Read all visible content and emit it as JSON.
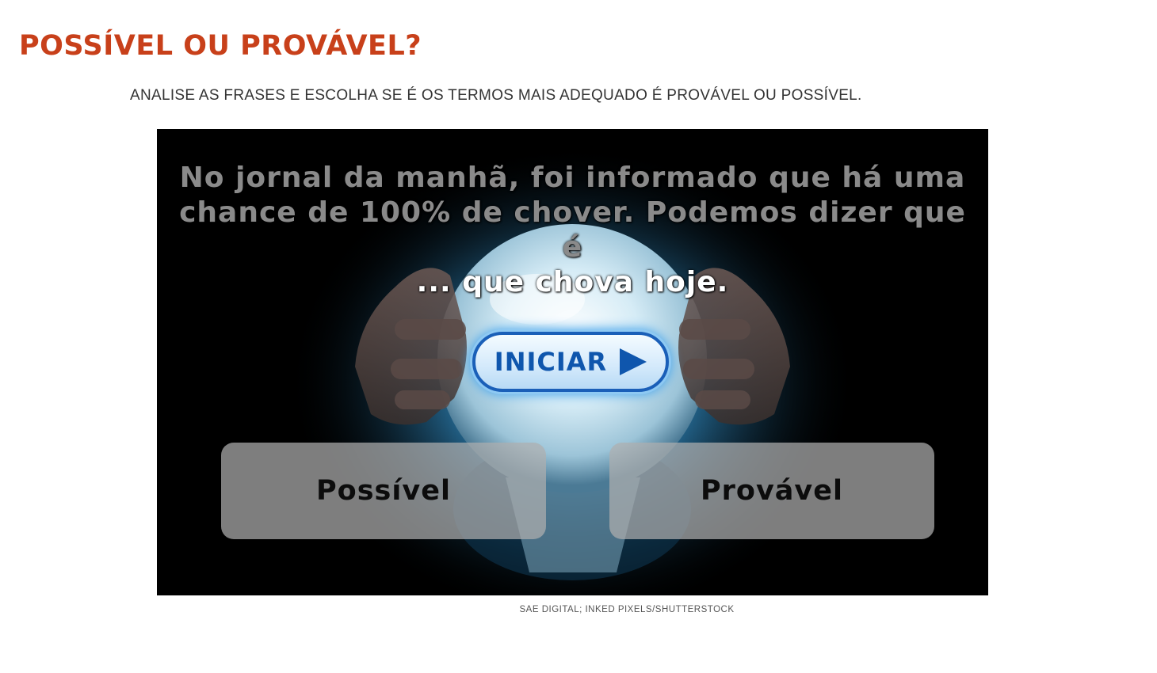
{
  "page": {
    "title": "POSSÍVEL OU PROVÁVEL?",
    "instructions": "ANALISE AS FRASES E ESCOLHA SE É OS TERMOS MAIS ADEQUADO É PROVÁVEL OU POSSÍVEL."
  },
  "game": {
    "question_line1": "No jornal da manhã, foi informado que há uma",
    "question_line2": "chance de 100% de chover. Podemos dizer que é",
    "question_line3": "... que chova hoje.",
    "start_label": "INICIAR",
    "start_icon": "play-icon",
    "options": [
      {
        "label": "Possível"
      },
      {
        "label": "Provável"
      }
    ]
  },
  "credit": "SAE DIGITAL; INKED PIXELS/SHUTTERSTOCK",
  "colors": {
    "title": "#c8401a",
    "start_button_text": "#0f56ad",
    "crystal_ball_glow": "#3aa6e8"
  }
}
